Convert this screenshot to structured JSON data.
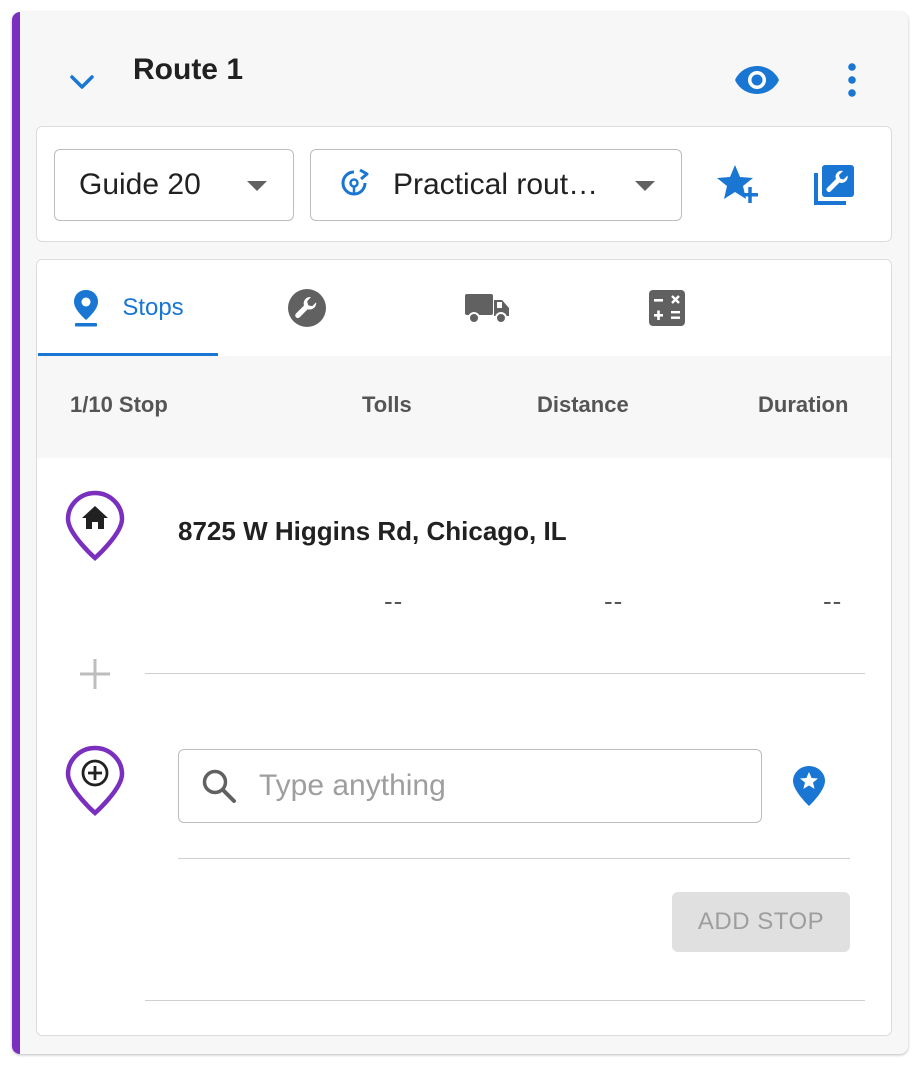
{
  "route": {
    "title": "Route 1"
  },
  "toolbar": {
    "guide_select": "Guide 20",
    "route_type_select": "Practical rout…"
  },
  "tabs": [
    {
      "label": "Stops",
      "icon": "map-marker-icon",
      "active": true
    },
    {
      "label": "",
      "icon": "wrench-icon",
      "active": false
    },
    {
      "label": "",
      "icon": "truck-icon",
      "active": false
    },
    {
      "label": "",
      "icon": "calculator-icon",
      "active": false
    }
  ],
  "columns": {
    "stop": "1/10 Stop",
    "tolls": "Tolls",
    "distance": "Distance",
    "duration": "Duration"
  },
  "stops": [
    {
      "address": "8725 W Higgins Rd, Chicago, IL",
      "tolls": "--",
      "distance": "--",
      "duration": "--"
    }
  ],
  "search": {
    "placeholder": "Type anything",
    "value": ""
  },
  "add_stop_button": "ADD STOP",
  "colors": {
    "accent": "#7b2fbe",
    "primary": "#1976d2",
    "disabled_bg": "#e0e0e0",
    "disabled_text": "#9e9e9e"
  }
}
